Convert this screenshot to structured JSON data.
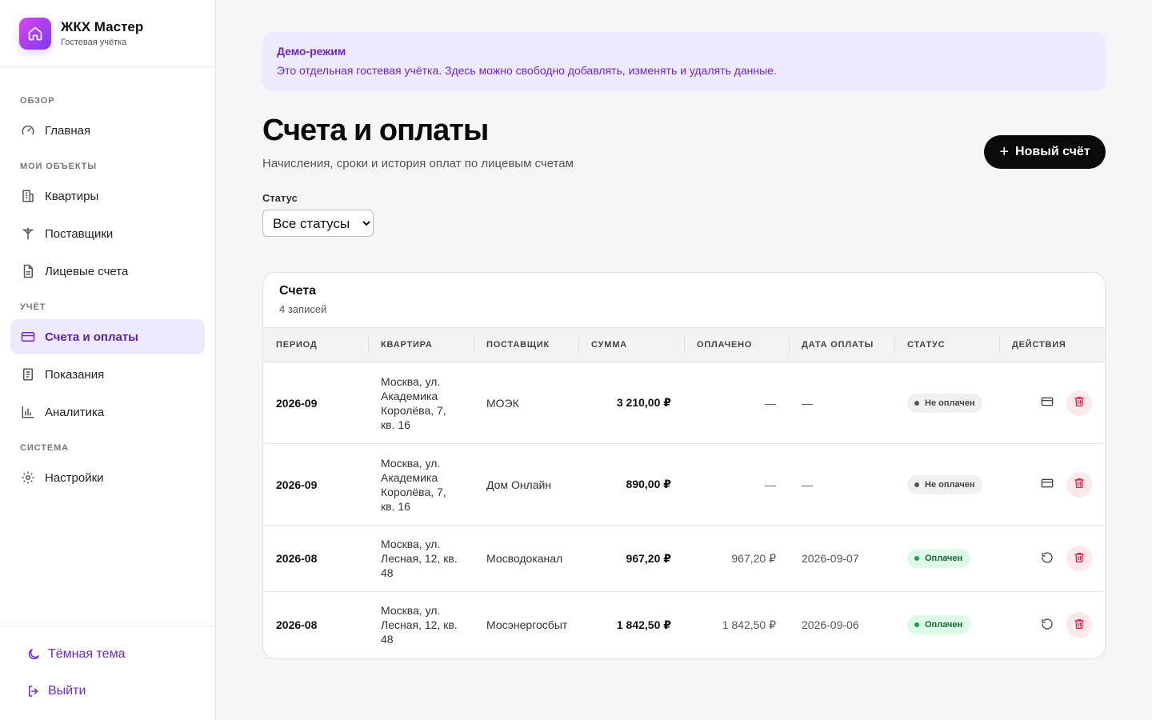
{
  "brand": {
    "title": "ЖКХ Мастер",
    "subtitle": "Гостевая учётка"
  },
  "nav": {
    "sections": [
      {
        "title": "ОБЗОР",
        "items": [
          {
            "label": "Главная",
            "icon": "gauge-icon"
          }
        ]
      },
      {
        "title": "МОИ ОБЪЕКТЫ",
        "items": [
          {
            "label": "Квартиры",
            "icon": "building-icon"
          },
          {
            "label": "Поставщики",
            "icon": "utility-pole-icon"
          },
          {
            "label": "Лицевые счета",
            "icon": "document-icon"
          }
        ]
      },
      {
        "title": "УЧЁТ",
        "items": [
          {
            "label": "Счета и оплаты",
            "icon": "credit-card-icon",
            "active": true
          },
          {
            "label": "Показания",
            "icon": "readings-icon"
          },
          {
            "label": "Аналитика",
            "icon": "bar-chart-icon"
          }
        ]
      },
      {
        "title": "СИСТЕМА",
        "items": [
          {
            "label": "Настройки",
            "icon": "gear-icon"
          }
        ]
      }
    ]
  },
  "bottom": {
    "theme_label": "Тёмная тема",
    "logout_label": "Выйти"
  },
  "demo": {
    "title": "Демо-режим",
    "text": "Это отдельная гостевая учётка. Здесь можно свободно добавлять, изменять и удалять данные."
  },
  "page": {
    "title": "Счета и оплаты",
    "subtitle": "Начисления, сроки и история оплат по лицевым счетам",
    "new_button": "Новый счёт"
  },
  "filter": {
    "label": "Статус",
    "selected": "Все статусы"
  },
  "table": {
    "title": "Счета",
    "count": "4 записей",
    "columns": [
      "ПЕРИОД",
      "КВАРТИРА",
      "ПОСТАВЩИК",
      "СУММА",
      "ОПЛАЧЕНО",
      "ДАТА ОПЛАТЫ",
      "СТАТУС",
      "ДЕЙСТВИЯ"
    ],
    "rows": [
      {
        "period": "2026-09",
        "apartment": "Москва, ул. Академика Королёва, 7, кв. 16",
        "provider": "МОЭК",
        "amount": "3 210,00 ₽",
        "paid": "—",
        "paid_date": "—",
        "status": "Не оплачен",
        "status_kind": "unpaid",
        "action": "pay"
      },
      {
        "period": "2026-09",
        "apartment": "Москва, ул. Академика Королёва, 7, кв. 16",
        "provider": "Дом Онлайн",
        "amount": "890,00 ₽",
        "paid": "—",
        "paid_date": "—",
        "status": "Не оплачен",
        "status_kind": "unpaid",
        "action": "pay"
      },
      {
        "period": "2026-08",
        "apartment": "Москва, ул. Лесная, 12, кв. 48",
        "provider": "Мосводоканал",
        "amount": "967,20 ₽",
        "paid": "967,20 ₽",
        "paid_date": "2026-09-07",
        "status": "Оплачен",
        "status_kind": "paid",
        "action": "undo"
      },
      {
        "period": "2026-08",
        "apartment": "Москва, ул. Лесная, 12, кв. 48",
        "provider": "Мосэнергосбыт",
        "amount": "1 842,50 ₽",
        "paid": "1 842,50 ₽",
        "paid_date": "2026-09-06",
        "status": "Оплачен",
        "status_kind": "paid",
        "action": "undo"
      }
    ]
  },
  "colors": {
    "accent": "#6d28d9",
    "accent_bg": "#ede9fe",
    "danger": "#e11d48",
    "success": "#16a34a"
  }
}
